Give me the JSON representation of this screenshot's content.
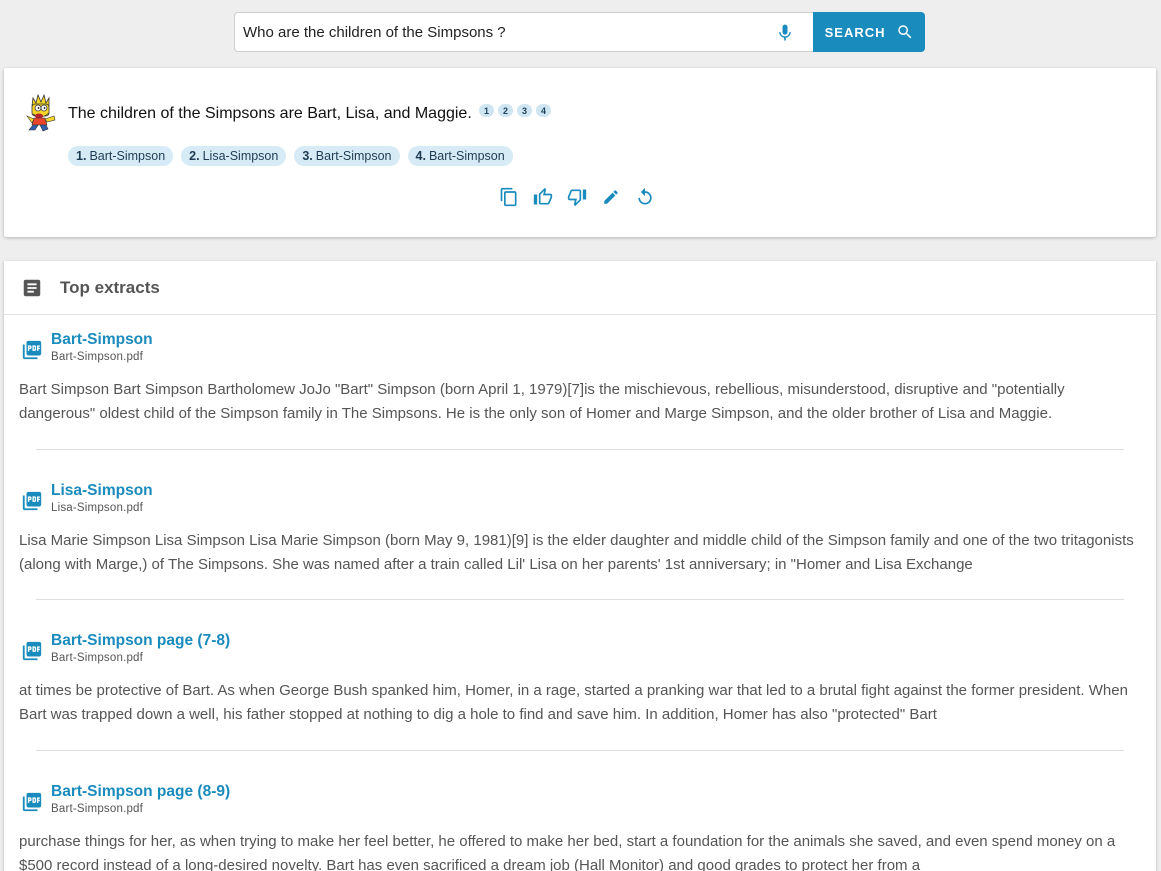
{
  "search": {
    "query": "Who are the children of the Simpsons ?",
    "button_label": "SEARCH"
  },
  "answer": {
    "text": "The children of the Simpsons are Bart, Lisa, and Maggie.",
    "refs": [
      "1",
      "2",
      "3",
      "4"
    ],
    "sources": [
      {
        "num": "1.",
        "label": "Bart-Simpson"
      },
      {
        "num": "2.",
        "label": "Lisa-Simpson"
      },
      {
        "num": "3.",
        "label": "Bart-Simpson"
      },
      {
        "num": "4.",
        "label": "Bart-Simpson"
      }
    ],
    "actions": [
      "copy-icon",
      "thumb-up-icon",
      "thumb-down-icon",
      "edit-icon",
      "regenerate-icon"
    ]
  },
  "extracts": {
    "title": "Top extracts",
    "items": [
      {
        "title": "Bart-Simpson",
        "file": "Bart-Simpson.pdf",
        "text": "Bart Simpson Bart Simpson Bartholomew JoJo \"Bart\" Simpson (born April 1, 1979)[7]is the mischievous, rebellious, misunderstood, disruptive and \"potentially dangerous\" oldest child of the Simpson family in The Simpsons. He is the only son of Homer and Marge Simpson, and the older brother of Lisa and Maggie."
      },
      {
        "title": "Lisa-Simpson",
        "file": "Lisa-Simpson.pdf",
        "text": "Lisa Marie Simpson Lisa Simpson Lisa Marie Simpson (born May 9, 1981)[9] is the elder daughter and middle child of the Simpson family and one of the two tritagonists (along with Marge,) of The Simpsons. She was named after a train called Lil' Lisa on her parents' 1st anniversary; in \"Homer and Lisa Exchange"
      },
      {
        "title": "Bart-Simpson page (7-8)",
        "file": "Bart-Simpson.pdf",
        "text": "at times be protective of Bart. As when George Bush spanked him, Homer, in a rage, started a pranking war that led to a brutal fight against the former president. When Bart was trapped down a well, his father stopped at nothing to dig a hole to find and save him. In addition, Homer has also \"protected\" Bart"
      },
      {
        "title": "Bart-Simpson page (8-9)",
        "file": "Bart-Simpson.pdf",
        "text": "purchase things for her, as when trying to make her feel better, he offered to make her bed, start a foundation for the animals she saved, and even spend money on a $500 record instead of a long-desired novelty. Bart has even sacrificed a dream job (Hall Monitor) and good grades to protect her from a"
      }
    ]
  }
}
